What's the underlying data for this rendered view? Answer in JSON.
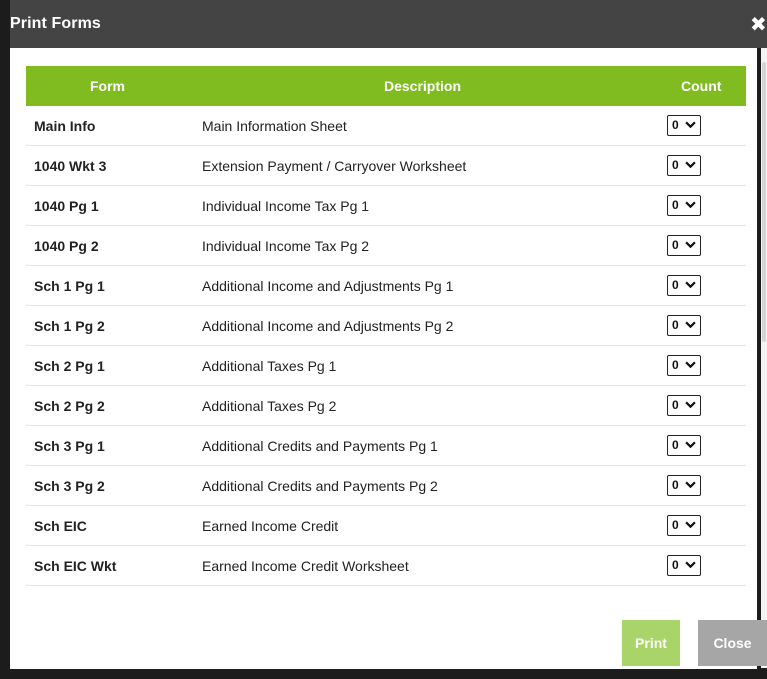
{
  "dialog": {
    "title": "Print Forms",
    "close_icon": "close-icon",
    "print_label": "Print",
    "close_label": "Close"
  },
  "table": {
    "columns": [
      "Form",
      "Description",
      "Count"
    ],
    "rows": [
      {
        "form": "Main Info",
        "description": "Main Information Sheet",
        "count": "0"
      },
      {
        "form": "1040 Wkt 3",
        "description": "Extension Payment / Carryover Worksheet",
        "count": "0"
      },
      {
        "form": "1040 Pg 1",
        "description": "Individual Income Tax Pg 1",
        "count": "0"
      },
      {
        "form": "1040 Pg 2",
        "description": "Individual Income Tax Pg 2",
        "count": "0"
      },
      {
        "form": "Sch 1 Pg 1",
        "description": "Additional Income and Adjustments Pg 1",
        "count": "0"
      },
      {
        "form": "Sch 1 Pg 2",
        "description": "Additional Income and Adjustments Pg 2",
        "count": "0"
      },
      {
        "form": "Sch 2 Pg 1",
        "description": "Additional Taxes Pg 1",
        "count": "0"
      },
      {
        "form": "Sch 2 Pg 2",
        "description": "Additional Taxes Pg 2",
        "count": "0"
      },
      {
        "form": "Sch 3 Pg 1",
        "description": "Additional Credits and Payments Pg 1",
        "count": "0"
      },
      {
        "form": "Sch 3 Pg 2",
        "description": "Additional Credits and Payments Pg 2",
        "count": "0"
      },
      {
        "form": "Sch EIC",
        "description": "Earned Income Credit",
        "count": "0"
      },
      {
        "form": "Sch EIC Wkt",
        "description": "Earned Income Credit Worksheet",
        "count": "0"
      }
    ]
  },
  "colors": {
    "header_green": "#80bc1f",
    "print_button": "#a8d46a",
    "close_button": "#a6a6a6",
    "titlebar": "#444444"
  }
}
